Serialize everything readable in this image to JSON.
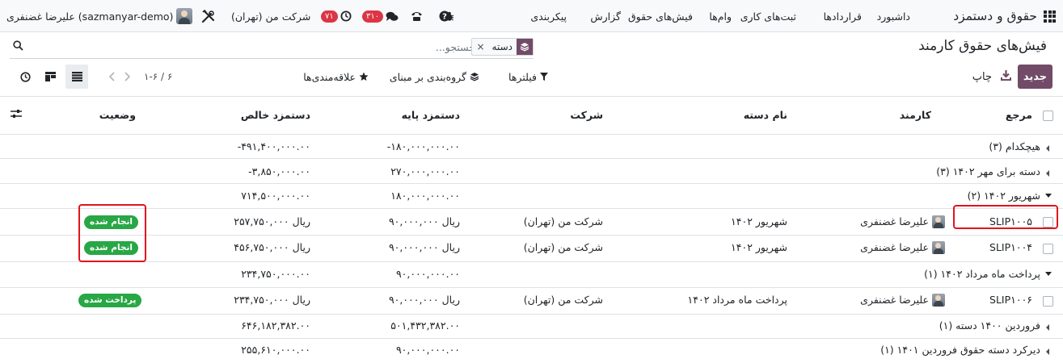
{
  "navbar": {
    "brand": "حقوق و دستمزد",
    "menu": [
      {
        "label": "داشبورد"
      },
      {
        "label": "قراردادها"
      },
      {
        "label": "ثبت‌های کاری"
      },
      {
        "label": "وام‌ها"
      },
      {
        "label": "فیش‌های حقوق"
      },
      {
        "label": "گزارش"
      },
      {
        "label": "پیکربندی"
      }
    ],
    "activity_count": "۷۱",
    "messages_count": "۳۱۰",
    "company": "شرکت من (تهران)",
    "user": "علیرضا غضنفری (sazmanyar-demo)",
    "accent_color": "#714b67",
    "badge_color": "#dc3545"
  },
  "control_panel": {
    "title": "فیش‌های حقوق کارمند",
    "search_placeholder": "جستجو...",
    "facet_label": "دسته",
    "new_button": "جدید",
    "print_button": "چاپ",
    "filters_label": "فیلترها",
    "groupby_label": "گروه‌بندی بر مبنای",
    "favorites_label": "علاقه‌مندی‌ها",
    "pager": "۱-۶ / ۶"
  },
  "table": {
    "headers": {
      "reference": "مرجع",
      "employee": "کارمند",
      "batch_name": "نام دسته",
      "company": "شرکت",
      "basic_wage": "دستمزد پایه",
      "net_wage": "دستمزد خالص",
      "status": "وضعیت"
    },
    "groups": [
      {
        "label": "هیچکدام (۳)",
        "basic": "-۱۸۰,۰۰۰,۰۰۰.۰۰",
        "net": "-۴۹۱,۴۰۰,۰۰۰.۰۰",
        "expanded": false
      },
      {
        "label": "دسته برای مهر ۱۴۰۲ (۳)",
        "basic": "۲۷۰,۰۰۰,۰۰۰.۰۰",
        "net": "-۳,۸۵۰,۰۰۰.۰۰",
        "expanded": false
      },
      {
        "label": "شهریور ۱۴۰۲ (۲)",
        "basic": "۱۸۰,۰۰۰,۰۰۰.۰۰",
        "net": "۷۱۴,۵۰۰,۰۰۰.۰۰",
        "expanded": true
      },
      {
        "label": "پرداخت ماه مرداد ۱۴۰۲ (۱)",
        "basic": "۹۰,۰۰۰,۰۰۰.۰۰",
        "net": "۲۳۴,۷۵۰,۰۰۰.۰۰",
        "expanded": true
      },
      {
        "label": "فروردین ۱۴۰۰ دسته (۱)",
        "basic": "۵۰۱,۴۳۲,۳۸۲.۰۰",
        "net": "۶۴۶,۱۸۲,۳۸۲.۰۰",
        "expanded": false
      },
      {
        "label": "دیرکرد دسته حقوق فروردین ۱۴۰۱ (۱)",
        "basic": "۹۰,۰۰۰,۰۰۰.۰۰",
        "net": "۲۵۵,۶۱۰,۰۰۰.۰۰",
        "expanded": false
      }
    ],
    "records": [
      {
        "ref": "SLIP۱۰۰۵",
        "employee": "علیرضا غضنفری",
        "batch": "شهریور ۱۴۰۲",
        "company": "شرکت من (تهران)",
        "basic": "ریال ۹۰,۰۰۰,۰۰۰",
        "net": "ریال ۲۵۷,۷۵۰,۰۰۰",
        "status": "انجام شده"
      },
      {
        "ref": "SLIP۱۰۰۴",
        "employee": "علیرضا غضنفری",
        "batch": "شهریور ۱۴۰۲",
        "company": "شرکت من (تهران)",
        "basic": "ریال ۹۰,۰۰۰,۰۰۰",
        "net": "ریال ۴۵۶,۷۵۰,۰۰۰",
        "status": "انجام شده"
      },
      {
        "ref": "SLIP۱۰۰۶",
        "employee": "علیرضا غضنفری",
        "batch": "پرداخت ماه مرداد ۱۴۰۲",
        "company": "شرکت من (تهران)",
        "basic": "ریال ۹۰,۰۰۰,۰۰۰",
        "net": "ریال ۲۳۴,۷۵۰,۰۰۰",
        "status": "پرداخت شده"
      }
    ],
    "status_color": "#28a745",
    "highlight_color": "#e0141e"
  }
}
